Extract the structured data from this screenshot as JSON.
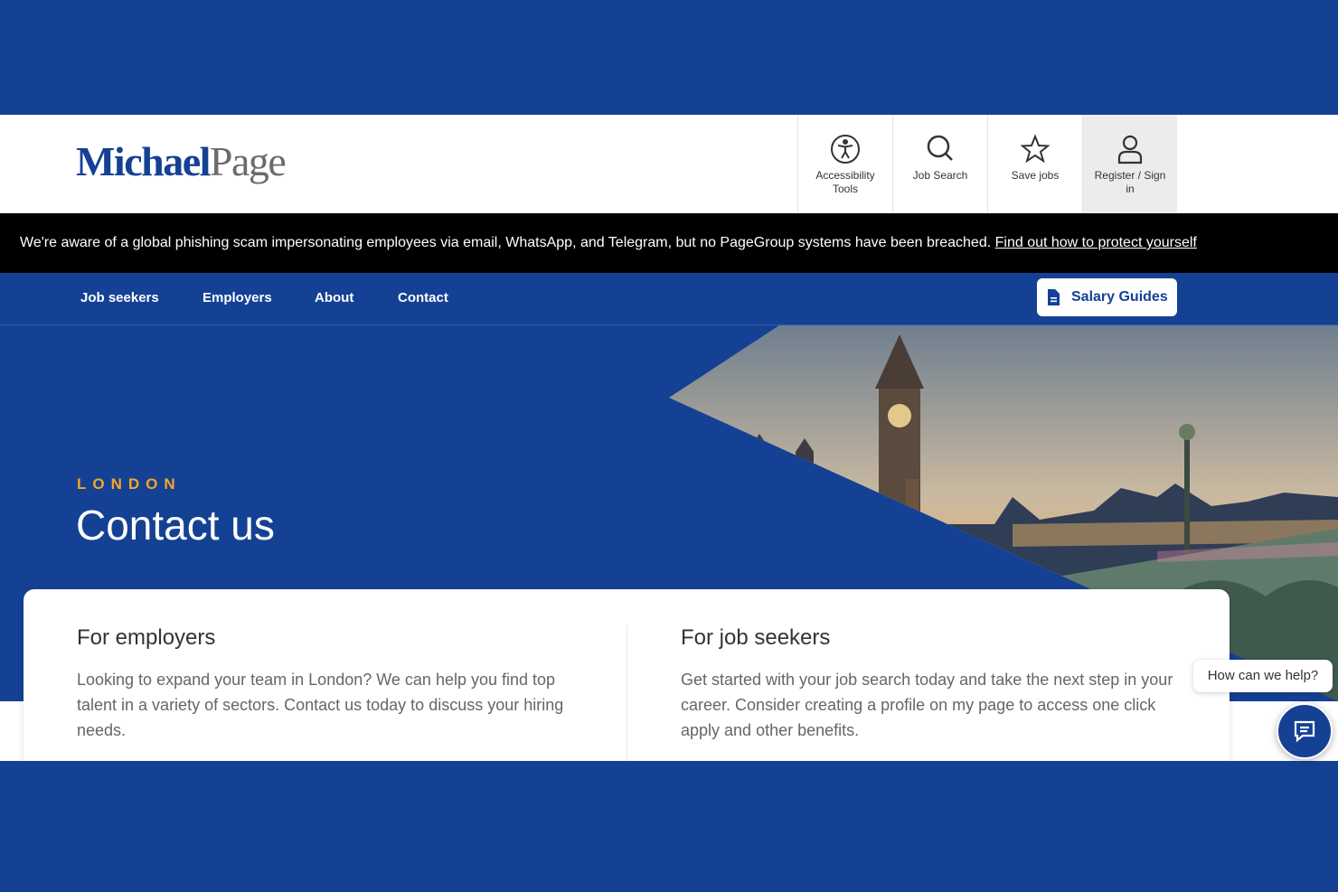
{
  "header": {
    "logo_part1": "Michael",
    "logo_part2": "Page",
    "tools": [
      {
        "label": "Accessibility Tools",
        "icon": "accessibility-icon"
      },
      {
        "label": "Job Search",
        "icon": "search-icon"
      },
      {
        "label": "Save jobs",
        "icon": "star-icon"
      },
      {
        "label": "Register / Sign in",
        "icon": "user-icon"
      }
    ]
  },
  "alert": {
    "text": "We're aware of a global phishing scam impersonating employees via email, WhatsApp, and Telegram, but no PageGroup systems have been breached. ",
    "link": "Find out how to protect yourself"
  },
  "nav": {
    "items": [
      "Job seekers",
      "Employers",
      "About",
      "Contact"
    ],
    "salary_button": "Salary Guides"
  },
  "hero": {
    "eyebrow": "LONDON",
    "title": "Contact us"
  },
  "cards": {
    "employers": {
      "title": "For employers",
      "body": "Looking to expand your team in London? We can help you find top talent in a variety of sectors. Contact us today to discuss your hiring needs."
    },
    "seekers": {
      "title": "For job seekers",
      "body": "Get started with your job search today and take the next step in your career. Consider creating a profile on my page to access one click apply and other benefits."
    }
  },
  "chat": {
    "prompt": "How can we help?"
  },
  "colors": {
    "brand_blue": "#154194",
    "accent_orange": "#f5a623",
    "alert_black": "#000000"
  }
}
